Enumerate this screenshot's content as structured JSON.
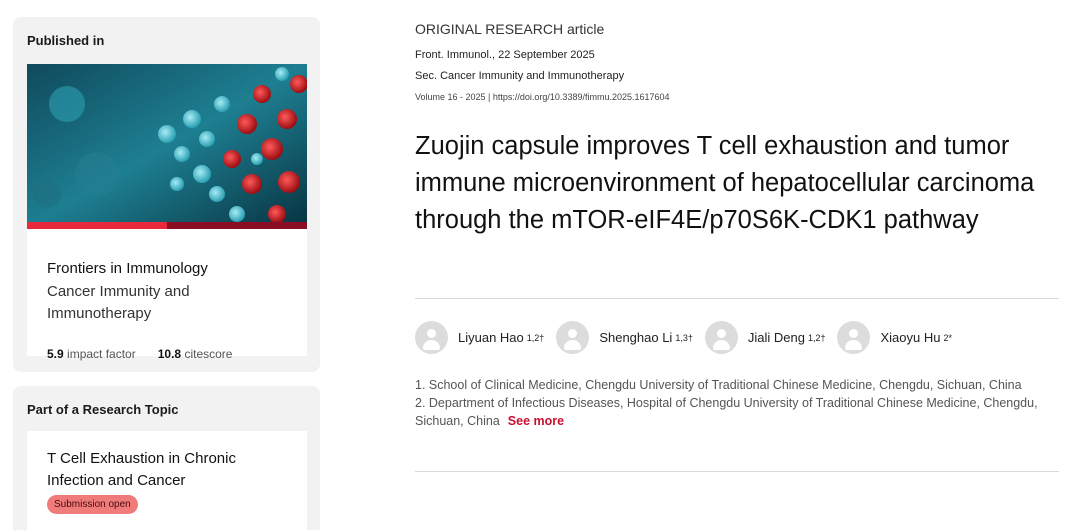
{
  "sidebar": {
    "published_label": "Published in",
    "journal_name": "Frontiers in Immunology",
    "journal_section": "Cancer Immunity and Immunotherapy",
    "impact_value": "5.9",
    "impact_label": "impact factor",
    "citescore_value": "10.8",
    "citescore_label": "citescore",
    "topic_label": "Part of a Research Topic",
    "topic_title": "T Cell Exhaustion in Chronic Infection and Cancer",
    "topic_badge": "Submission open"
  },
  "article": {
    "type": "ORIGINAL RESEARCH article",
    "journal_date": "Front. Immunol., 22 September 2025",
    "section": "Sec. Cancer Immunity and Immunotherapy",
    "volume_doi": "Volume 16 - 2025 | https://doi.org/10.3389/fimmu.2025.1617604",
    "title": "Zuojin capsule improves T cell exhaustion and tumor immune microenvironment of hepatocellular carcinoma through the mTOR-eIF4E/p70S6K-CDK1 pathway",
    "authors": [
      {
        "name": "Liyuan Hao",
        "sup": "1,2†"
      },
      {
        "name": "Shenghao Li",
        "sup": "1,3†"
      },
      {
        "name": "Jiali Deng",
        "sup": "1,2†"
      },
      {
        "name": "Xiaoyu Hu",
        "sup": "2*"
      }
    ],
    "affiliation_1": "1. School of Clinical Medicine, Chengdu University of Traditional Chinese Medicine, Chengdu, Sichuan, China",
    "affiliation_2": "2. Department of Infectious Diseases, Hospital of Chengdu University of Traditional Chinese Medicine, Chengdu, Sichuan, China",
    "see_more": "See more"
  },
  "colors": {
    "accent_red": "#c8102e",
    "bar_red": "#e8293b",
    "bar_dark": "#8b0d24",
    "badge_bg": "#f07b7b"
  }
}
